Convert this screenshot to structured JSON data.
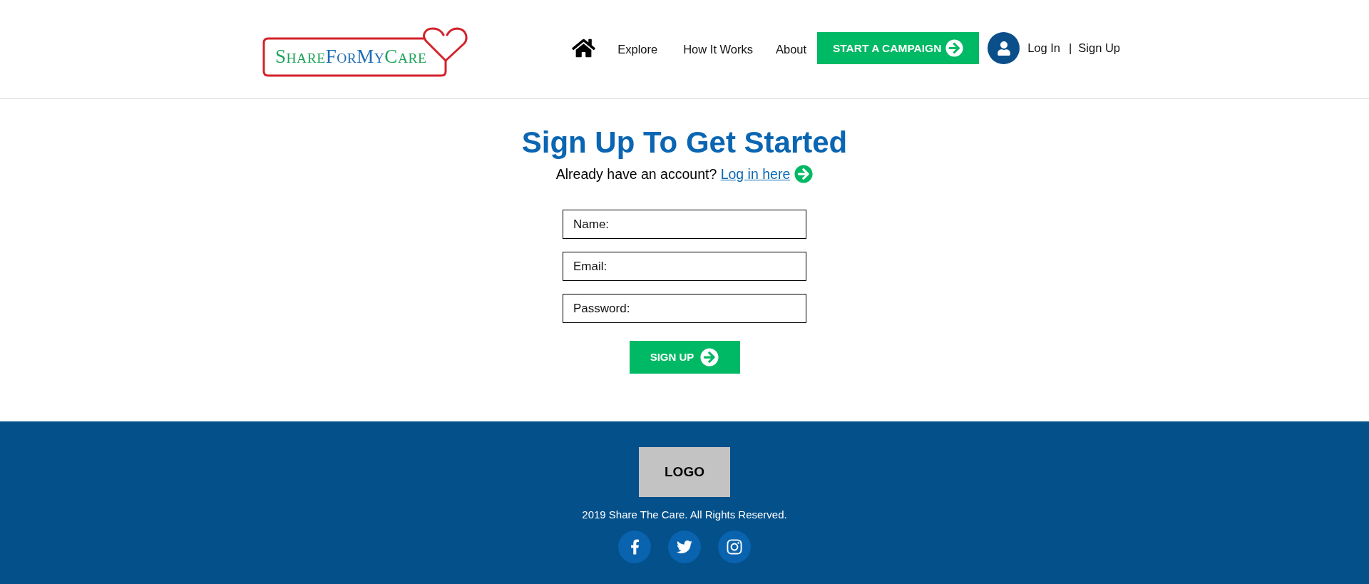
{
  "header": {
    "logo": {
      "words": [
        {
          "text": "SHARE",
          "color": "#1fa35a"
        },
        {
          "text": "FOR",
          "color": "#1a6cb5"
        },
        {
          "text": "MY",
          "color": "#1a6cb5"
        },
        {
          "text": "CARE",
          "color": "#1fa35a"
        }
      ]
    },
    "nav": {
      "links": [
        "Explore",
        "How It Works",
        "About"
      ],
      "cta": "START A CAMPAIGN",
      "login": "Log In",
      "separator": "|",
      "signup": "Sign Up"
    }
  },
  "main": {
    "title": "Sign Up To Get Started",
    "prompt": "Already have an account?",
    "login_link": "Log in here",
    "fields": [
      {
        "placeholder": "Name:"
      },
      {
        "placeholder": "Email:"
      },
      {
        "placeholder": "Password:"
      }
    ],
    "submit": "SIGN UP"
  },
  "footer": {
    "logo": "LOGO",
    "copyright": "2019 Share The Care. All Rights Reserved."
  }
}
